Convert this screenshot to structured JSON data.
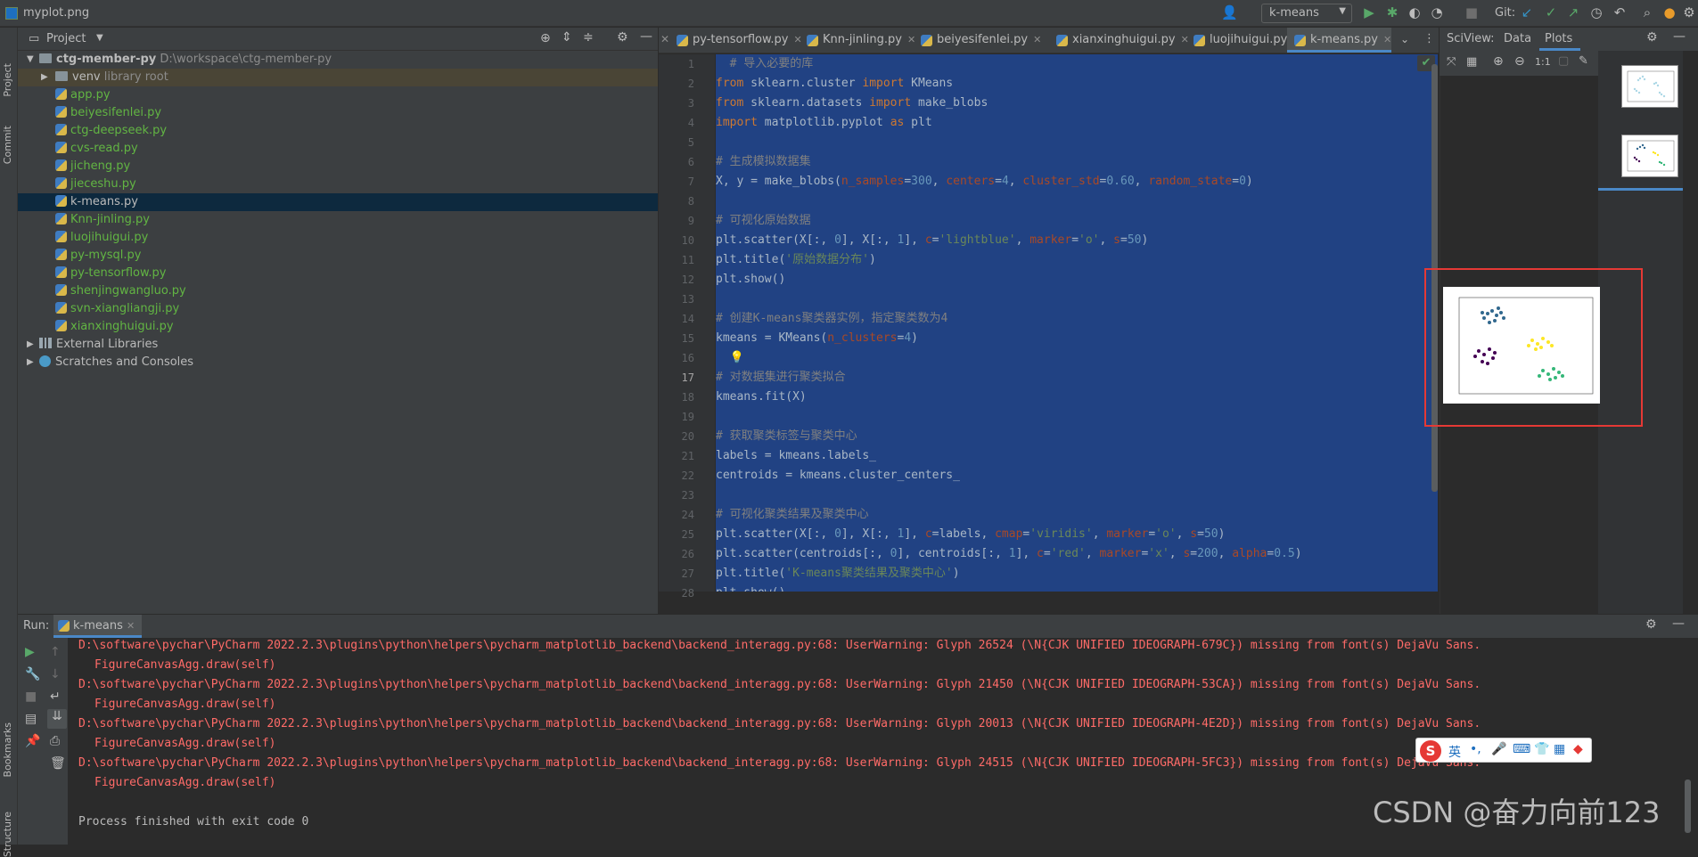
{
  "window": {
    "title": "myplot.png"
  },
  "toolbar": {
    "run_config": "k-means",
    "git_label": "Git:"
  },
  "left_strip": {
    "project_tab": "Project",
    "commit_tab": "Commit",
    "bookmarks_tab": "Bookmarks",
    "structure_tab": "Structure"
  },
  "project_panel": {
    "title": "Project",
    "root": {
      "name": "ctg-member-py",
      "path": "D:\\workspace\\ctg-member-py"
    },
    "venv": {
      "name": "venv",
      "hint": "library root"
    },
    "files": [
      "app.py",
      "beiyesifenlei.py",
      "ctg-deepseek.py",
      "cvs-read.py",
      "jicheng.py",
      "jieceshu.py",
      "k-means.py",
      "Knn-jinling.py",
      "luojihuigui.py",
      "py-mysql.py",
      "py-tensorflow.py",
      "shenjingwangluo.py",
      "svn-xiangliangji.py",
      "xianxinghuigui.py"
    ],
    "external_libraries": "External Libraries",
    "scratches": "Scratches and Consoles"
  },
  "editor": {
    "tabs": [
      "py-tensorflow.py",
      "Knn-jinling.py",
      "beiyesifenlei.py",
      "xianxinghuigui.py",
      "luojihuigui.py",
      "k-means.py"
    ],
    "active_tab": "k-means.py",
    "line_numbers": [
      "1",
      "2",
      "3",
      "4",
      "5",
      "6",
      "7",
      "8",
      "9",
      "10",
      "11",
      "12",
      "13",
      "14",
      "15",
      "16",
      "17",
      "18",
      "19",
      "20",
      "21",
      "22",
      "23",
      "24",
      "25",
      "26",
      "27",
      "28"
    ]
  },
  "sciview": {
    "label": "SciView:",
    "tab_data": "Data",
    "tab_plots": "Plots",
    "zoom_label": "1:1"
  },
  "run": {
    "label": "Run:",
    "tab": "k-means",
    "lines": [
      "D:\\software\\pychar\\PyCharm 2022.2.3\\plugins\\python\\helpers\\pycharm_matplotlib_backend\\backend_interagg.py:68: UserWarning: Glyph 26524 (\\N{CJK UNIFIED IDEOGRAPH-679C}) missing from font(s) DejaVu Sans.",
      "FigureCanvasAgg.draw(self)",
      "D:\\software\\pychar\\PyCharm 2022.2.3\\plugins\\python\\helpers\\pycharm_matplotlib_backend\\backend_interagg.py:68: UserWarning: Glyph 21450 (\\N{CJK UNIFIED IDEOGRAPH-53CA}) missing from font(s) DejaVu Sans.",
      "FigureCanvasAgg.draw(self)",
      "D:\\software\\pychar\\PyCharm 2022.2.3\\plugins\\python\\helpers\\pycharm_matplotlib_backend\\backend_interagg.py:68: UserWarning: Glyph 20013 (\\N{CJK UNIFIED IDEOGRAPH-4E2D}) missing from font(s) DejaVu Sans.",
      "FigureCanvasAgg.draw(self)",
      "D:\\software\\pychar\\PyCharm 2022.2.3\\plugins\\python\\helpers\\pycharm_matplotlib_backend\\backend_interagg.py:68: UserWarning: Glyph 24515 (\\N{CJK UNIFIED IDEOGRAPH-5FC3}) missing from font(s) DejaVu Sans.",
      "FigureCanvasAgg.draw(self)",
      "",
      "Process finished with exit code 0"
    ]
  },
  "ime": {
    "lang": "英"
  },
  "watermark": "CSDN @奋力向前123",
  "colors": {
    "accent": "#4a88c7",
    "selection": "#214283",
    "error_text": "#ff6b68",
    "highlight_box": "#e53935"
  }
}
